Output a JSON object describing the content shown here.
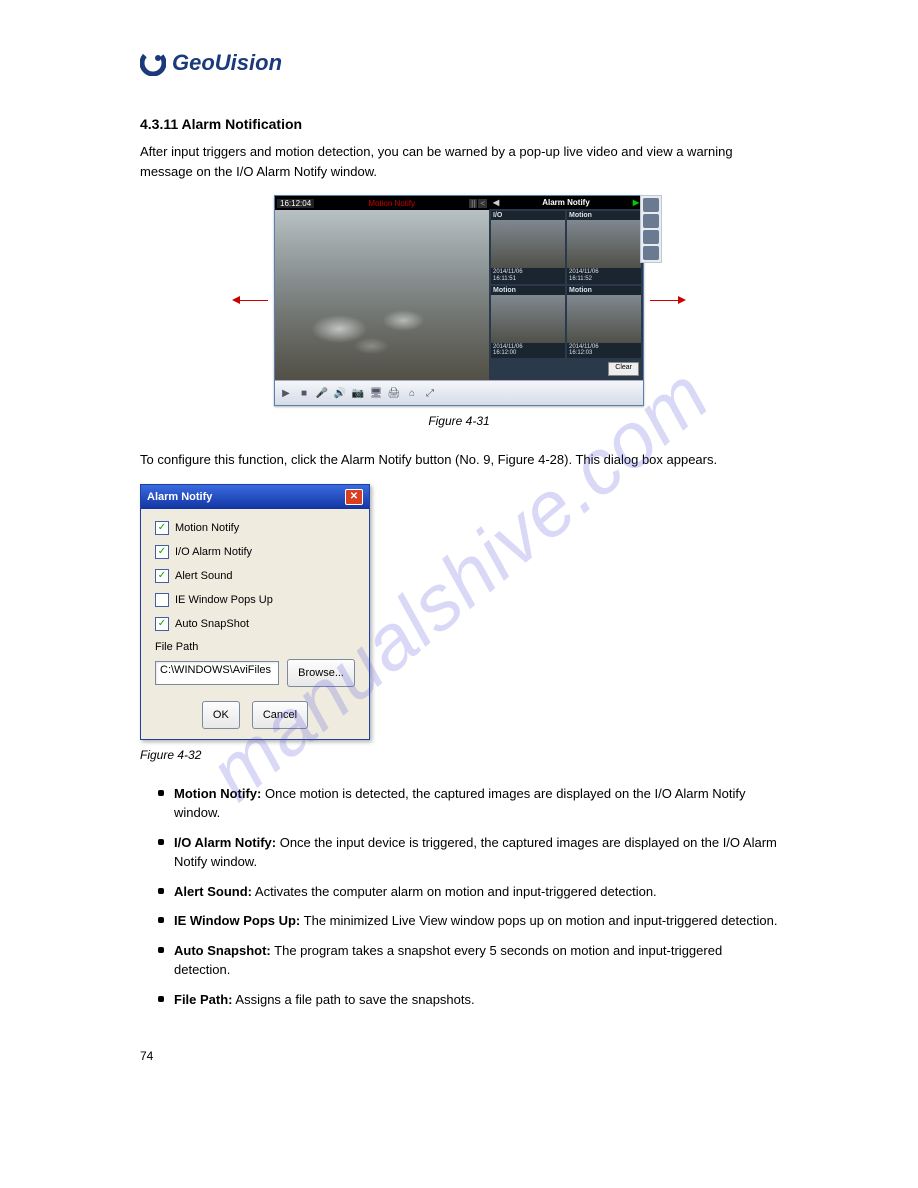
{
  "logo": {
    "text": "GeoUision"
  },
  "section_title": "4.3.11 Alarm Notification",
  "intro_paragraph": "After input triggers and motion detection, you can be warned by a pop-up live video and view a warning message on the I/O Alarm Notify window.",
  "player": {
    "time": "16:12:04",
    "status": "Motion Notify",
    "pause_icon": "||",
    "back_icon": "<",
    "alarm_header": "Alarm Notify",
    "tri_left": "◀",
    "tri_right": "▶",
    "thumbs": [
      {
        "label": "I/O",
        "ts": "2014/11/06\n16:11:51"
      },
      {
        "label": "Motion",
        "ts": "2014/11/06\n16:11:52"
      },
      {
        "label": "Motion",
        "ts": "2014/11/06\n16:12:00"
      },
      {
        "label": "Motion",
        "ts": "2014/11/06\n16:12:03"
      }
    ],
    "clear_label": "Clear",
    "toolbar_icons": [
      "▶",
      "■",
      "🎤",
      "🔊",
      "📷",
      "🖥",
      "🖨",
      "⌂",
      "⤢"
    ]
  },
  "figure_caption_1": "Figure 4-31",
  "config_intro": "To configure this function, click the Alarm Notify button (No. 9, Figure 4-28). This dialog box appears.",
  "dialog": {
    "title": "Alarm Notify",
    "opts": [
      {
        "checked": true,
        "label": "Motion Notify"
      },
      {
        "checked": true,
        "label": "I/O Alarm Notify"
      },
      {
        "checked": true,
        "label": "Alert Sound"
      },
      {
        "checked": false,
        "label": "IE Window Pops Up"
      },
      {
        "checked": true,
        "label": "Auto SnapShot"
      }
    ],
    "file_path_label": "File Path",
    "file_path_value": "C:\\WINDOWS\\AviFiles",
    "browse": "Browse...",
    "ok": "OK",
    "cancel": "Cancel"
  },
  "figure_caption_2": "Figure 4-32",
  "bullets": [
    {
      "term": "Motion Notify:",
      "text": " Once motion is detected, the captured images are displayed on the I/O Alarm Notify window."
    },
    {
      "term": "I/O Alarm Notify:",
      "text": " Once the input device is triggered, the captured images are displayed on the I/O Alarm Notify window."
    },
    {
      "term": "Alert Sound:",
      "text": " Activates the computer alarm on motion and input-triggered detection."
    },
    {
      "term": "IE Window Pops Up:",
      "text": " The minimized Live View window pops up on motion and input-triggered detection."
    },
    {
      "term": "Auto Snapshot:",
      "text": " The program takes a snapshot every 5 seconds on motion and input-triggered detection."
    },
    {
      "term": "File Path:",
      "text": " Assigns a file path to save the snapshots."
    }
  ],
  "page_number": "74",
  "watermark": "manualshive.com"
}
